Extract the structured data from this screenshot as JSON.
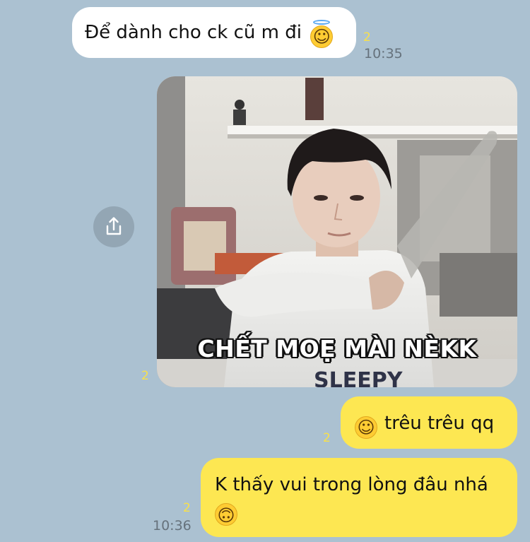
{
  "messages": {
    "incoming": {
      "text": "Để dành cho ck cũ m đi",
      "emoji": "smiling-face-with-halo",
      "read_count": "2",
      "time": "10:35"
    },
    "photo": {
      "caption": "CHẾT MOẸ MÀI NÈKK",
      "read_count": "2",
      "share_icon": "share-icon"
    },
    "outgoing_1": {
      "emoji": "slightly-smiling-face",
      "text": "trêu trêu qq",
      "read_count": "2"
    },
    "outgoing_2": {
      "text": "K thấy vui trong lòng đâu nhá",
      "emoji": "upside-down-face",
      "read_count": "2",
      "time": "10:36"
    }
  },
  "colors": {
    "background": "#abc1d1",
    "incoming_bubble": "#ffffff",
    "outgoing_bubble": "#fde752",
    "read_count": "#f8e04a",
    "timestamp": "#66727c"
  }
}
